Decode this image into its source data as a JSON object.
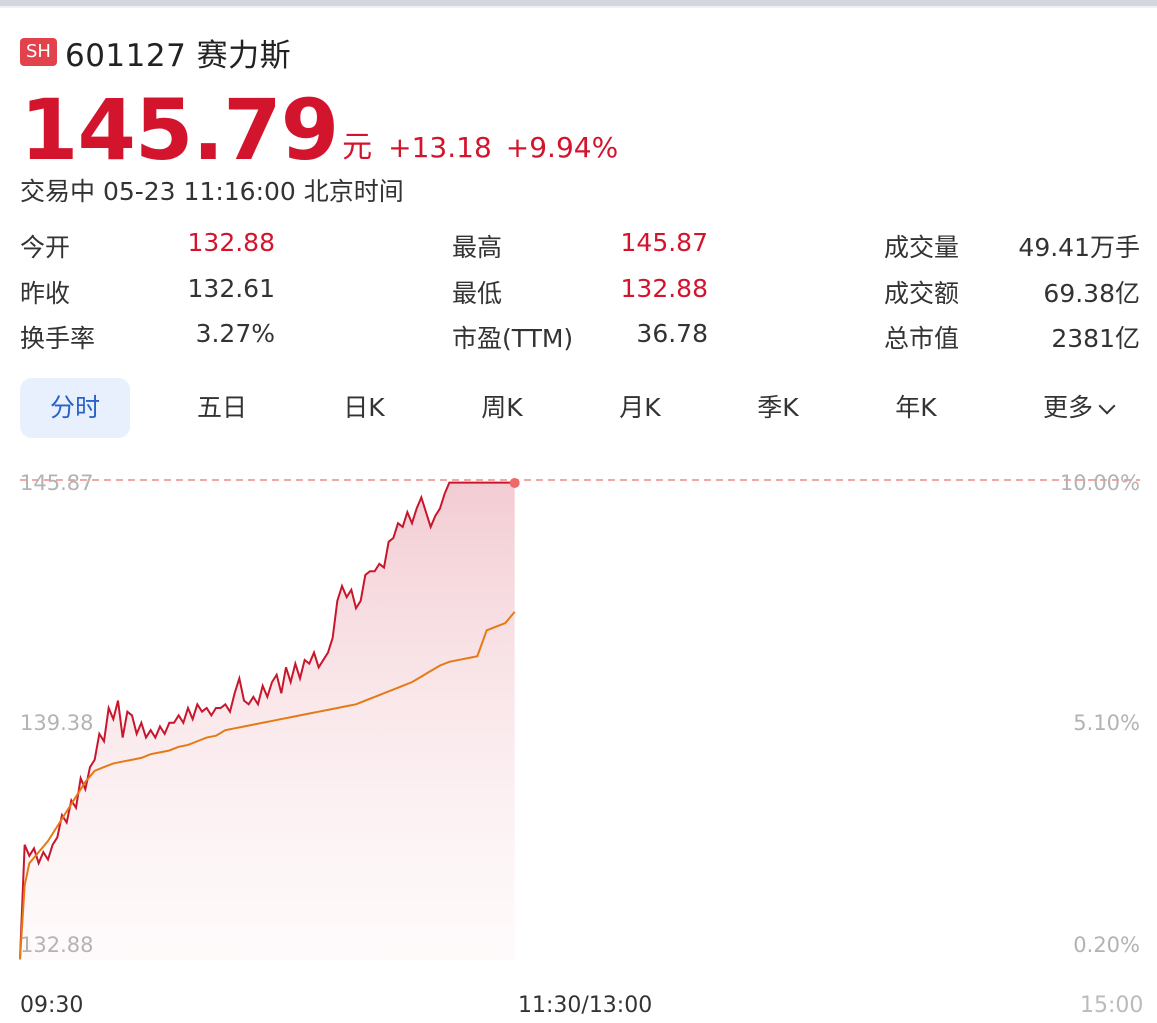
{
  "stock": {
    "market": "SH",
    "code_name": "601127 赛力斯",
    "price": "145.79",
    "unit": "元",
    "change": "+13.18",
    "change_pct": "+9.94%",
    "status": "交易中 05-23 11:16:00 北京时间"
  },
  "stats": {
    "open_label": "今开",
    "open": "132.88",
    "high_label": "最高",
    "high": "145.87",
    "volume_label": "成交量",
    "volume": "49.41万手",
    "prev_close_label": "昨收",
    "prev_close": "132.61",
    "low_label": "最低",
    "low": "132.88",
    "amount_label": "成交额",
    "amount": "69.38亿",
    "turnover_label": "换手率",
    "turnover": "3.27%",
    "pe_label": "市盈(TTM)",
    "pe": "36.78",
    "mktcap_label": "总市值",
    "mktcap": "2381亿"
  },
  "tabs": [
    "分时",
    "五日",
    "日K",
    "周K",
    "月K",
    "季K",
    "年K",
    "更多"
  ],
  "active_tab": "分时",
  "time_labels": {
    "start": "09:30",
    "mid": "11:30/13:00",
    "end": "15:00"
  },
  "colors": {
    "up": "#d3142d",
    "avg": "#e57a14",
    "accent": "#2a62c9",
    "badge": "#e2424c"
  },
  "chart_data": {
    "type": "line",
    "y_left_ticks": [
      "145.87",
      "139.38",
      "132.88"
    ],
    "y_right_ticks": [
      "10.00%",
      "5.10%",
      "0.20%"
    ],
    "ylim": [
      132.88,
      145.87
    ],
    "high_line": 145.87,
    "x_range_minutes": [
      0,
      240
    ],
    "series": [
      {
        "x": [
          0,
          1,
          2,
          3,
          4,
          5,
          6,
          7,
          8,
          9,
          10,
          11,
          12,
          13,
          14,
          15,
          16,
          17,
          18,
          19,
          20,
          21,
          22,
          23,
          24,
          25,
          26,
          27,
          28,
          29,
          30,
          31,
          32,
          33,
          34,
          35,
          36,
          37,
          38,
          39,
          40,
          41,
          42,
          43,
          44,
          45,
          46,
          47,
          48,
          49,
          50,
          51,
          52,
          53,
          54,
          55,
          56,
          57,
          58,
          59,
          60,
          61,
          62,
          63,
          64,
          65,
          66,
          67,
          68,
          69,
          70,
          71,
          72,
          73,
          74,
          75,
          76,
          77,
          78,
          79,
          80,
          81,
          82,
          83,
          84,
          85,
          86,
          87,
          88,
          89,
          90,
          91,
          92,
          93,
          94,
          95,
          96,
          97,
          98,
          99,
          100,
          101,
          102,
          103,
          104,
          105,
          106
        ],
        "values": [
          132.9,
          136.0,
          135.7,
          135.9,
          135.5,
          135.8,
          135.6,
          136.0,
          136.2,
          136.8,
          136.6,
          137.2,
          137.0,
          137.8,
          137.5,
          138.1,
          138.3,
          139.0,
          138.8,
          139.7,
          139.4,
          139.9,
          138.9,
          139.6,
          139.5,
          139.0,
          139.3,
          138.9,
          139.1,
          138.9,
          139.2,
          139.0,
          139.3,
          139.3,
          139.5,
          139.3,
          139.7,
          139.4,
          139.8,
          139.6,
          139.7,
          139.5,
          139.7,
          139.7,
          139.8,
          139.6,
          140.1,
          140.5,
          139.9,
          139.8,
          140.0,
          139.8,
          140.3,
          140.0,
          140.4,
          140.6,
          140.1,
          140.8,
          140.4,
          140.9,
          140.5,
          141.0,
          140.9,
          141.2,
          140.8,
          141.0,
          141.2,
          141.6,
          142.6,
          143.0,
          142.7,
          142.9,
          142.4,
          142.6,
          143.3,
          143.4,
          143.4,
          143.6,
          143.5,
          144.2,
          144.3,
          144.7,
          144.6,
          145.0,
          144.7,
          145.1,
          145.4,
          145.0,
          144.6,
          144.9,
          145.1,
          145.5,
          145.8,
          145.8,
          145.8,
          145.8,
          145.8,
          145.8,
          145.8,
          145.8,
          145.8,
          145.8,
          145.8,
          145.8,
          145.8,
          145.8,
          145.79
        ],
        "x_plot": [
          0,
          1,
          2,
          3,
          4,
          5,
          6,
          7,
          8,
          9,
          10,
          11,
          12,
          13,
          14,
          15,
          16,
          17,
          18,
          19,
          20,
          21,
          22,
          23,
          24,
          25,
          26,
          27,
          28,
          29,
          30,
          31,
          32,
          33,
          34,
          35,
          36,
          37,
          38,
          39,
          40,
          41,
          42,
          43,
          44,
          45,
          46,
          47,
          48,
          49,
          50,
          51,
          52,
          53,
          54,
          55,
          56,
          57,
          58,
          59,
          60,
          61,
          62,
          63,
          64,
          65,
          66,
          67,
          68,
          69,
          70,
          71,
          72,
          73,
          74,
          75,
          76,
          77,
          78,
          79,
          80,
          81,
          82,
          83,
          84,
          85,
          86,
          87,
          88,
          89,
          90,
          91,
          92,
          93,
          94,
          95,
          96,
          97,
          98,
          99,
          100,
          101,
          102,
          103,
          104,
          105,
          106
        ]
      },
      {
        "x": [
          0,
          1,
          2,
          4,
          6,
          8,
          10,
          12,
          14,
          16,
          18,
          20,
          22,
          24,
          26,
          28,
          30,
          32,
          34,
          36,
          38,
          40,
          42,
          44,
          46,
          48,
          50,
          52,
          54,
          56,
          58,
          60,
          62,
          64,
          66,
          68,
          70,
          72,
          74,
          76,
          78,
          80,
          82,
          84,
          86,
          88,
          90,
          92,
          94,
          96,
          98,
          100,
          102,
          104,
          106
        ],
        "values": [
          132.9,
          134.9,
          135.5,
          135.8,
          136.1,
          136.5,
          136.9,
          137.3,
          137.7,
          138.0,
          138.1,
          138.2,
          138.25,
          138.3,
          138.35,
          138.45,
          138.5,
          138.55,
          138.65,
          138.7,
          138.8,
          138.9,
          138.95,
          139.1,
          139.15,
          139.2,
          139.25,
          139.3,
          139.35,
          139.4,
          139.45,
          139.5,
          139.55,
          139.6,
          139.65,
          139.7,
          139.75,
          139.8,
          139.9,
          140.0,
          140.1,
          140.2,
          140.3,
          140.4,
          140.55,
          140.7,
          140.85,
          140.95,
          141.0,
          141.05,
          141.1,
          141.8,
          141.9,
          142.0,
          142.3
        ]
      }
    ]
  }
}
